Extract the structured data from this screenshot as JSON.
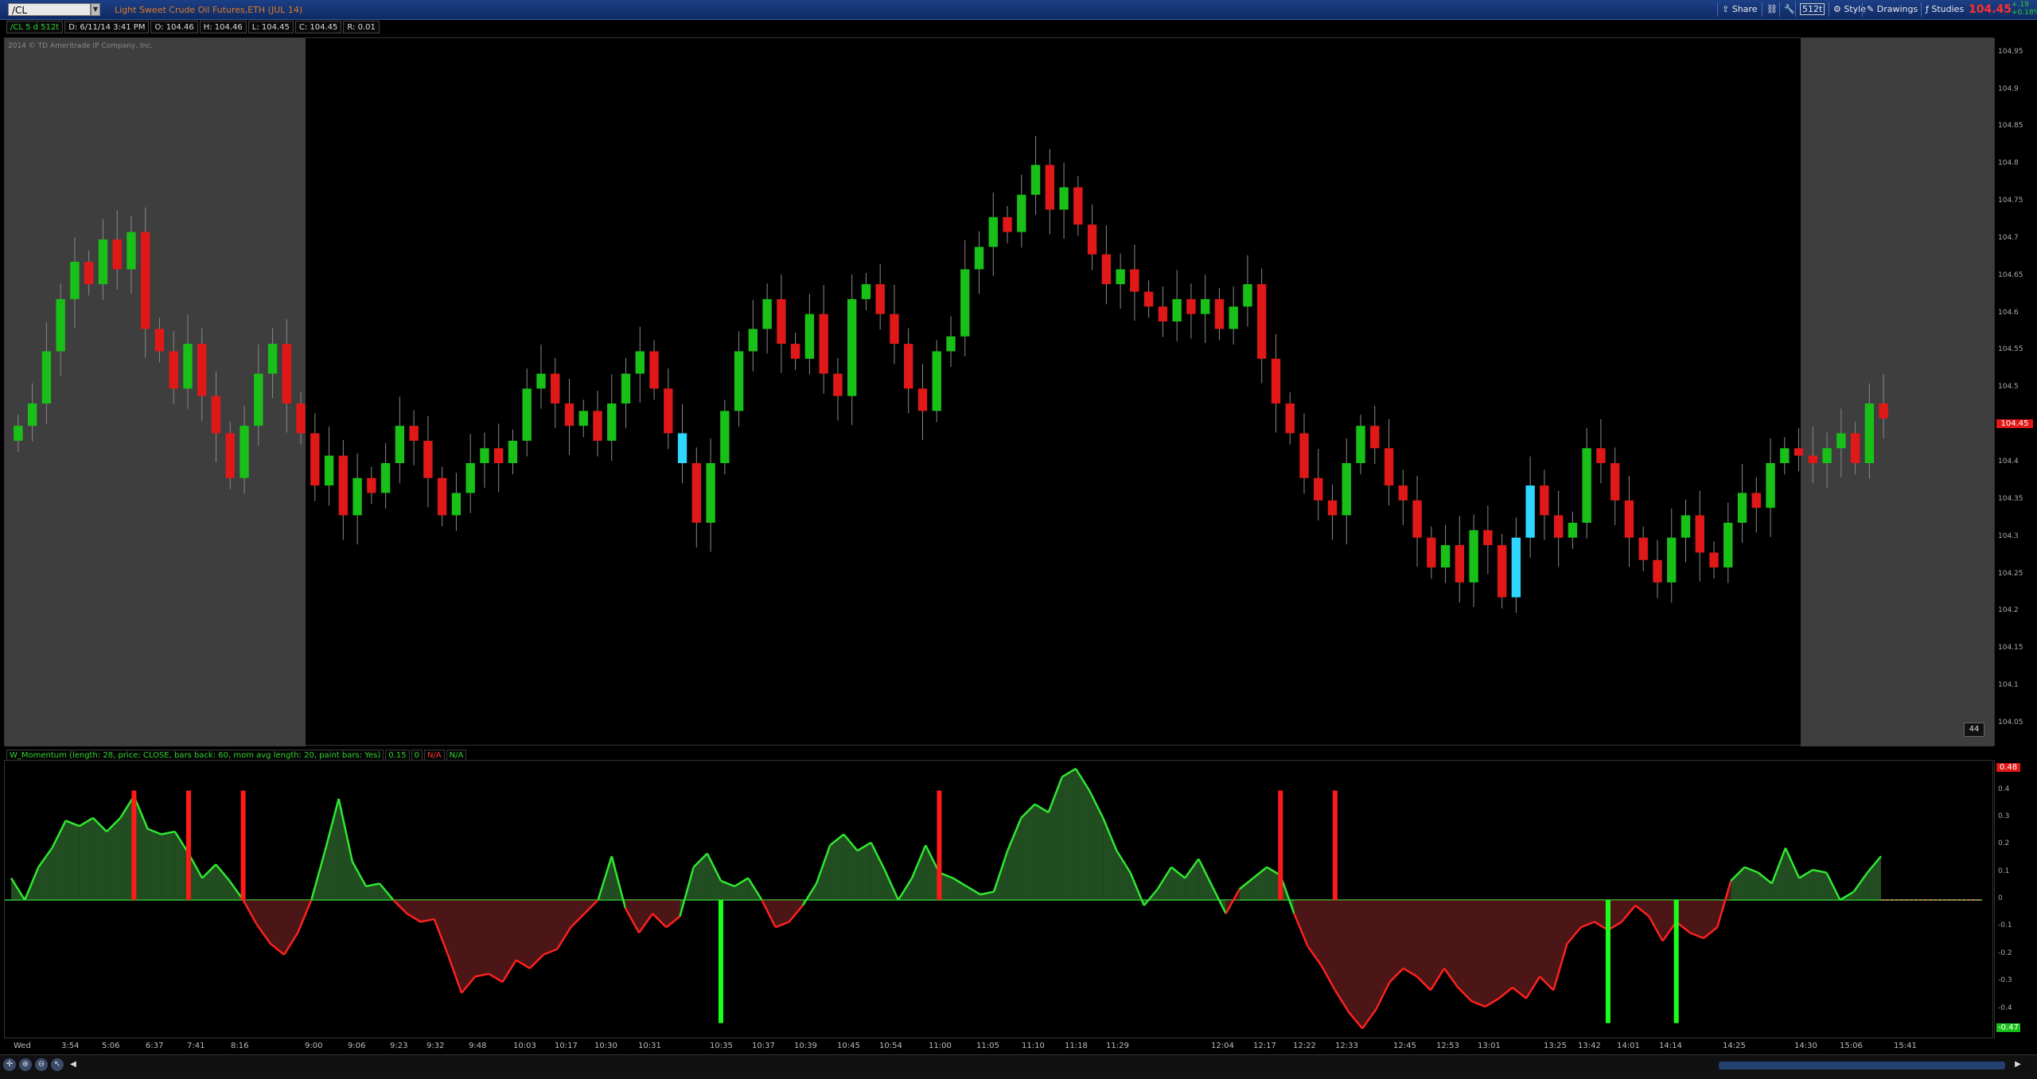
{
  "window": {
    "symbol": "/CL",
    "instrument_title": "Light Sweet Crude Oil Futures,ETH (JUL 14)",
    "toolbar": {
      "share": "Share",
      "timeframe": "512t",
      "style": "Style",
      "drawings": "Drawings",
      "studies": "Studies"
    },
    "last_price": "104.45",
    "net_change_lines": [
      "+.19",
      "+0.18%"
    ]
  },
  "info_bar": {
    "chart_id": "/CL 5 d 512t",
    "date": "D: 6/11/14 3:41 PM",
    "open": "O: 104.46",
    "high": "H: 104.46",
    "low": "L: 104.45",
    "close": "C: 104.45",
    "range": "R: 0.01"
  },
  "copyright": "2014 © TD Ameritrade IP Company, Inc.",
  "price_panel": {
    "last_price_tag": "104.45",
    "badge": "44",
    "axis_ticks": [
      "104.95",
      "104.9",
      "104.85",
      "104.8",
      "104.75",
      "104.7",
      "104.65",
      "104.6",
      "104.55",
      "104.5",
      "104.45",
      "104.4",
      "104.35",
      "104.3",
      "104.25",
      "104.2",
      "104.15",
      "104.1",
      "104.05"
    ]
  },
  "study": {
    "label": "W_Momentum (length: 28, price: CLOSE, bars back: 60, mom avg length: 20, paint bars: Yes)",
    "v1": "0.15",
    "v2": "0",
    "v3": "N/A",
    "v4": "N/A",
    "axis_ticks": [
      "0.4",
      "0.3",
      "0.2",
      "0.1",
      "0",
      "-0.1",
      "-0.2",
      "-0.3",
      "-0.4"
    ],
    "max_tag": "0.48",
    "min_tag": "-0.47"
  },
  "time_axis": [
    "Wed",
    "3:54",
    "5:06",
    "6:37",
    "7:41",
    "8:16",
    "9:00",
    "9:06",
    "9:23",
    "9:32",
    "9:48",
    "10:03",
    "10:17",
    "10:30",
    "10:31",
    "10:35",
    "10:37",
    "10:39",
    "10:45",
    "10:54",
    "11:00",
    "11:05",
    "11:10",
    "11:18",
    "11:29",
    "12:04",
    "12:17",
    "12:22",
    "12:33",
    "12:45",
    "12:53",
    "13:01",
    "13:25",
    "13:42",
    "14:01",
    "14:14",
    "14:25",
    "14:30",
    "15:06",
    "15:41"
  ],
  "colors": {
    "up": "#18c018",
    "down": "#e01818",
    "highlight": "#2fd6ff",
    "background": "#000000",
    "extended_hours": "#3e3e3e"
  },
  "chart_data": [
    {
      "type": "candlestick",
      "title": "Light Sweet Crude Oil Futures,ETH (JUL 14)",
      "ylim": [
        104.02,
        104.97
      ],
      "close_series": [
        104.45,
        104.48,
        104.55,
        104.62,
        104.67,
        104.64,
        104.7,
        104.66,
        104.71,
        104.58,
        104.55,
        104.5,
        104.56,
        104.49,
        104.44,
        104.38,
        104.45,
        104.52,
        104.56,
        104.48,
        104.44,
        104.37,
        104.41,
        104.33,
        104.38,
        104.36,
        104.4,
        104.45,
        104.43,
        104.38,
        104.33,
        104.36,
        104.4,
        104.42,
        104.4,
        104.43,
        104.5,
        104.52,
        104.48,
        104.45,
        104.47,
        104.43,
        104.48,
        104.52,
        104.55,
        104.5,
        104.44,
        104.4,
        104.32,
        104.4,
        104.47,
        104.55,
        104.58,
        104.62,
        104.56,
        104.54,
        104.6,
        104.52,
        104.49,
        104.62,
        104.64,
        104.6,
        104.56,
        104.5,
        104.47,
        104.55,
        104.57,
        104.66,
        104.69,
        104.73,
        104.71,
        104.76,
        104.8,
        104.74,
        104.77,
        104.72,
        104.68,
        104.64,
        104.66,
        104.63,
        104.61,
        104.59,
        104.62,
        104.6,
        104.62,
        104.58,
        104.61,
        104.64,
        104.54,
        104.48,
        104.44,
        104.38,
        104.35,
        104.33,
        104.4,
        104.45,
        104.42,
        104.37,
        104.35,
        104.3,
        104.26,
        104.29,
        104.24,
        104.31,
        104.29,
        104.22,
        104.3,
        104.37,
        104.33,
        104.3,
        104.32,
        104.42,
        104.4,
        104.35,
        104.3,
        104.27,
        104.24,
        104.3,
        104.33,
        104.28,
        104.26,
        104.32,
        104.36,
        104.34,
        104.4,
        104.42,
        104.41,
        104.4,
        104.42,
        104.44,
        104.4,
        104.48,
        104.46
      ]
    },
    {
      "type": "area",
      "title": "W_Momentum (length: 28, price: CLOSE, bars back: 60, mom avg length: 20, paint bars: Yes)",
      "ylim": [
        -0.48,
        0.48
      ],
      "series": [
        {
          "values": [
            0.08,
            0.0,
            0.12,
            0.19,
            0.29,
            0.27,
            0.3,
            0.25,
            0.3,
            0.38,
            0.26,
            0.24,
            0.25,
            0.17,
            0.08,
            0.13,
            0.07,
            0.0,
            -0.09,
            -0.16,
            -0.2,
            -0.12,
            0.0,
            0.18,
            0.37,
            0.14,
            0.05,
            0.06,
            0.0,
            -0.05,
            -0.08,
            -0.07,
            -0.2,
            -0.34,
            -0.28,
            -0.27,
            -0.3,
            -0.22,
            -0.25,
            -0.2,
            -0.18,
            -0.1,
            -0.05,
            0.0,
            0.16,
            -0.03,
            -0.12,
            -0.05,
            -0.1,
            -0.06,
            0.12,
            0.17,
            0.07,
            0.05,
            0.08,
            0.0,
            -0.1,
            -0.08,
            -0.02,
            0.06,
            0.2,
            0.24,
            0.18,
            0.21,
            0.11,
            0.0,
            0.08,
            0.2,
            0.1,
            0.08,
            0.05,
            0.02,
            0.03,
            0.18,
            0.3,
            0.35,
            0.32,
            0.45,
            0.48,
            0.4,
            0.3,
            0.18,
            0.1,
            -0.02,
            0.04,
            0.12,
            0.08,
            0.15,
            0.05,
            -0.05,
            0.04,
            0.08,
            0.12,
            0.09,
            -0.05,
            -0.17,
            -0.24,
            -0.33,
            -0.41,
            -0.47,
            -0.4,
            -0.3,
            -0.25,
            -0.28,
            -0.33,
            -0.25,
            -0.32,
            -0.37,
            -0.39,
            -0.36,
            -0.32,
            -0.36,
            -0.28,
            -0.33,
            -0.16,
            -0.1,
            -0.08,
            -0.11,
            -0.08,
            -0.02,
            -0.06,
            -0.15,
            -0.08,
            -0.12,
            -0.14,
            -0.1,
            0.07,
            0.12,
            0.1,
            0.06,
            0.19,
            0.08,
            0.11,
            0.1,
            0.0,
            0.03,
            0.1,
            0.16
          ]
        }
      ],
      "signal_bars": {
        "red_up": [
          9,
          13,
          17,
          68,
          93,
          97
        ],
        "green_down": [
          52,
          117,
          122
        ]
      }
    }
  ]
}
